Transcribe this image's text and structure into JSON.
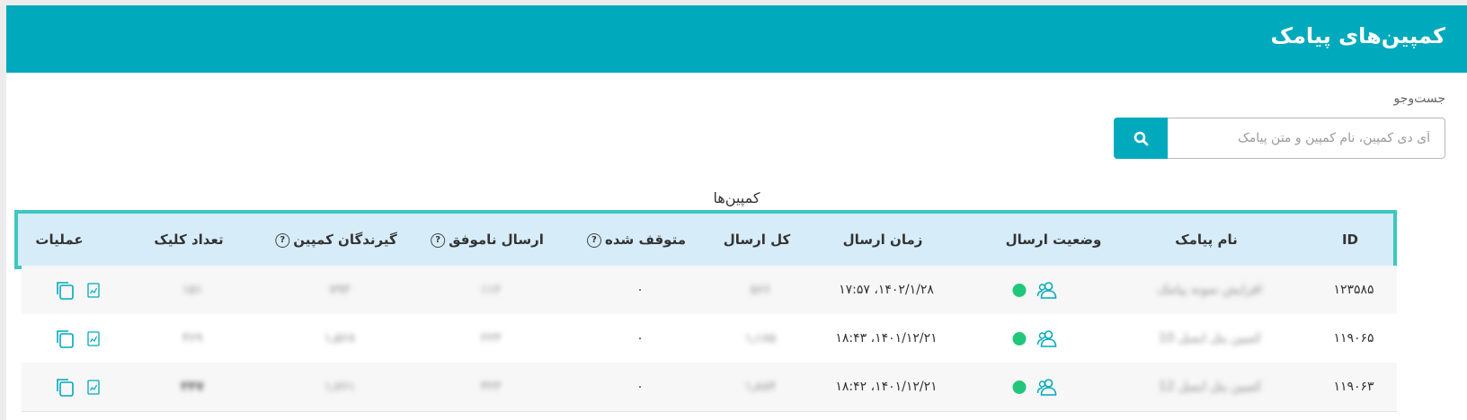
{
  "header": {
    "title": "کمپین‌های پیامک"
  },
  "search": {
    "label": "جست‌وجو",
    "placeholder": "آی دی کمپین، نام کمپین و متن پیامک"
  },
  "table": {
    "caption": "کمپین‌ها",
    "columns": [
      {
        "key": "id",
        "label": "ID",
        "help": false
      },
      {
        "key": "name",
        "label": "نام پیامک",
        "help": false
      },
      {
        "key": "status",
        "label": "وضعیت ارسال",
        "help": false
      },
      {
        "key": "time",
        "label": "زمان ارسال",
        "help": false
      },
      {
        "key": "total",
        "label": "کل ارسال",
        "help": false
      },
      {
        "key": "stopped",
        "label": "متوقف شده",
        "help": true
      },
      {
        "key": "failed",
        "label": "ارسال ناموفق",
        "help": true
      },
      {
        "key": "recipients",
        "label": "گیرندگان کمپین",
        "help": true
      },
      {
        "key": "clicks",
        "label": "تعداد کلیک",
        "help": false
      },
      {
        "key": "ops",
        "label": "عملیات",
        "help": false
      }
    ],
    "help_glyph": "?",
    "rows": [
      {
        "id": "۱۲۳۵۸۵",
        "name": "افزایش نمونه پیامک",
        "status_icon": "users-icon",
        "status_color": "#22c67a",
        "time": "۱۴۰۲/۱/۲۸، ۱۷:۵۷",
        "total": "۵۶۶",
        "stopped": "۰",
        "failed": "۱۱۲",
        "recipients": "۷۹۳",
        "clicks": "۱۵۱"
      },
      {
        "id": "۱۱۹۰۶۵",
        "name": "کمپین پنل ایمیل 10",
        "status_icon": "users-icon",
        "status_color": "#22c67a",
        "time": "۱۴۰۱/۱۲/۲۱، ۱۸:۴۳",
        "total": "۱٫۱۸۵",
        "stopped": "۰",
        "failed": "۲۲۳",
        "recipients": "۱٫۵۶۸",
        "clicks": "۳۶۹"
      },
      {
        "id": "۱۱۹۰۶۳",
        "name": "کمپین پنل ایمیل 12",
        "status_icon": "users-icon",
        "status_color": "#22c67a",
        "time": "۱۴۰۱/۱۲/۲۱، ۱۸:۴۲",
        "total": "۱٫۸۸۴",
        "stopped": "۰",
        "failed": "۳۲۳",
        "recipients": "۱٫۷۶۱",
        "clicks": "۳۴۷"
      }
    ]
  },
  "icons": {
    "search": "search-icon",
    "status": "users-icon",
    "report": "report-icon",
    "copy": "copy-icon"
  },
  "colors": {
    "brand": "#00a9bc",
    "header_bg": "#d6ecf9",
    "header_border": "#3ec7c0",
    "status_ok": "#22c67a"
  }
}
